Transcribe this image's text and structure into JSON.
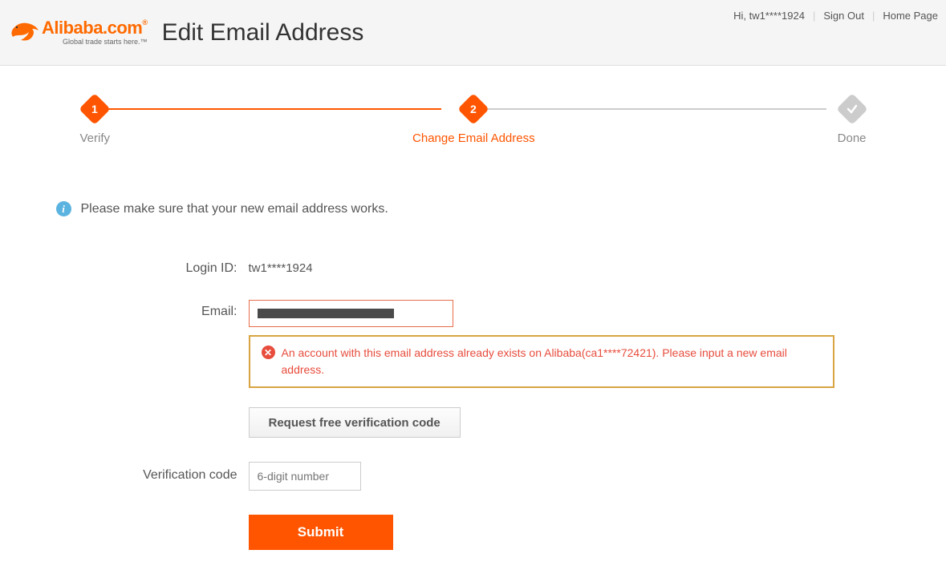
{
  "header": {
    "logo_main": "Alibaba",
    "logo_com": ".com",
    "logo_reg": "®",
    "logo_tagline": "Global trade starts here.™",
    "page_title": "Edit Email Address",
    "greeting": "Hi, tw1****1924",
    "sign_out": "Sign Out",
    "home_page": "Home Page"
  },
  "steps": {
    "s1_num": "1",
    "s1_label": "Verify",
    "s2_num": "2",
    "s2_label": "Change Email Address",
    "s3_label": "Done"
  },
  "info": {
    "text": "Please make sure that your new email address works."
  },
  "form": {
    "login_id_label": "Login ID:",
    "login_id_value": "tw1****1924",
    "email_label": "Email:",
    "error_text": "An account with this email address already exists on Alibaba(ca1****72421). Please input a new email address.",
    "request_button": "Request free verification code",
    "code_label": "Verification code",
    "code_placeholder": "6-digit number",
    "submit_button": "Submit"
  }
}
